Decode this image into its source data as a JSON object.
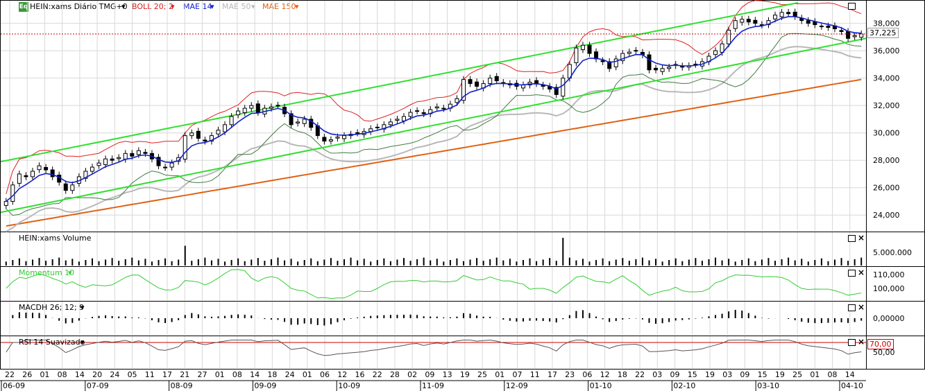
{
  "header": {
    "eq_badge": "Eq",
    "instrument": "HEIN:xams Diário TMG+0",
    "indicators": [
      {
        "label": "BOLL 20; 2",
        "color": "#d42020"
      },
      {
        "label": "MAE 14",
        "color": "#1020c8"
      },
      {
        "label": "MAE 50",
        "color": "#b8b8b8"
      },
      {
        "label": "MAE 150",
        "color": "#e06010"
      }
    ]
  },
  "colors": {
    "channel": "#2ee02e",
    "bollinger": "#e02020",
    "bollinger_lower": "#407a40",
    "mae14": "#1020c8",
    "mae50": "#b8b8b8",
    "mae150": "#e06010",
    "candle": "#000000",
    "grid": "#d8d8d8",
    "last_price_line": "#cc0000",
    "momentum": "#33cc33",
    "rsi": "#555555"
  },
  "chart_data": [
    {
      "type": "candlestick",
      "pane": "price",
      "y_ticks": [
        "38,000",
        "36,000",
        "34,000",
        "32,000",
        "30,000",
        "28,000",
        "26,000",
        "24,000"
      ],
      "ylim": [
        23000,
        39500
      ],
      "last_price_label": "37,225",
      "last_price": 37225,
      "grid": true,
      "series_close": [
        25000,
        26200,
        27000,
        26800,
        27200,
        27600,
        27300,
        26800,
        26400,
        25800,
        26200,
        26800,
        27200,
        27500,
        27800,
        28100,
        28000,
        28200,
        28500,
        28300,
        28700,
        28500,
        28100,
        27600,
        27500,
        27800,
        28200,
        29800,
        30000,
        29600,
        29400,
        29800,
        30200,
        30600,
        31200,
        31600,
        31800,
        32000,
        31500,
        31800,
        31900,
        32000,
        31400,
        30600,
        30800,
        31000,
        30400,
        29800,
        29400,
        29500,
        29700,
        29800,
        29900,
        30000,
        30100,
        30300,
        30400,
        30600,
        30800,
        31000,
        31200,
        31500,
        31600,
        31400,
        31700,
        31900,
        31800,
        32100,
        32500,
        33900,
        33600,
        33400,
        33600,
        34000,
        33800,
        33600,
        33500,
        33400,
        33500,
        33700,
        33600,
        33400,
        33200,
        32800,
        34000,
        35000,
        36200,
        36400,
        35800,
        35400,
        35200,
        34700,
        35400,
        35800,
        35900,
        36000,
        35700,
        34600,
        34600,
        34700,
        34800,
        35000,
        34800,
        34900,
        35000,
        35200,
        35600,
        36000,
        36500,
        37500,
        38200,
        38300,
        38100,
        38000,
        37900,
        38200,
        38600,
        38800,
        38700,
        38500,
        38200,
        38000,
        37900,
        37800,
        37700,
        37600,
        37400,
        36900,
        37100,
        37225
      ],
      "series": [
        {
          "name": "BOLL 20; 2"
        },
        {
          "name": "MAE 14"
        },
        {
          "name": "MAE 50"
        },
        {
          "name": "MAE 150"
        }
      ]
    },
    {
      "type": "bar",
      "pane": "volume",
      "title": "HEIN:xams Volume",
      "y_ticks": [
        "5.000.000"
      ],
      "ylim": [
        0,
        10000000
      ],
      "spikes": [
        {
          "index": 27,
          "value": 7500000
        },
        {
          "index": 84,
          "value": 10500000
        }
      ]
    },
    {
      "type": "line",
      "pane": "momentum",
      "title": "Momentum 10",
      "y_ticks": [
        "110,000",
        "100,000"
      ],
      "ylim": [
        93000,
        114000
      ]
    },
    {
      "type": "bar",
      "pane": "macd",
      "title": "MACDH 26; 12; 9",
      "y_ticks": [
        "0,00000"
      ],
      "ylim": [
        -1,
        1
      ]
    },
    {
      "type": "line",
      "pane": "rsi",
      "title": "RSI 14 Suavizado",
      "y_ticks": [
        "70,00",
        "50,00"
      ],
      "ylim": [
        20,
        80
      ],
      "overbought_label": "70,00"
    }
  ],
  "x_axis": {
    "days": [
      "22",
      "26",
      "01",
      "08",
      "14",
      "20",
      "24",
      "05",
      "11",
      "17",
      "21",
      "27",
      "01",
      "08",
      "14",
      "18",
      "24",
      "01",
      "06",
      "12",
      "16",
      "22",
      "28",
      "02",
      "09",
      "13",
      "19",
      "25",
      "01",
      "07",
      "11",
      "17",
      "23",
      "06",
      "12",
      "18",
      "22",
      "03",
      "09",
      "15",
      "19",
      "03",
      "09",
      "15",
      "19",
      "25",
      "01",
      "08",
      "14"
    ],
    "months": [
      "06-09",
      "07-09",
      "08-09",
      "09-09",
      "10-09",
      "11-09",
      "12-09",
      "01-10",
      "02-10",
      "03-10",
      "04-10"
    ]
  },
  "pane_controls": {
    "restore_icon": "window-restore-icon",
    "close_icon": "close-icon",
    "close_glyph": "×"
  }
}
